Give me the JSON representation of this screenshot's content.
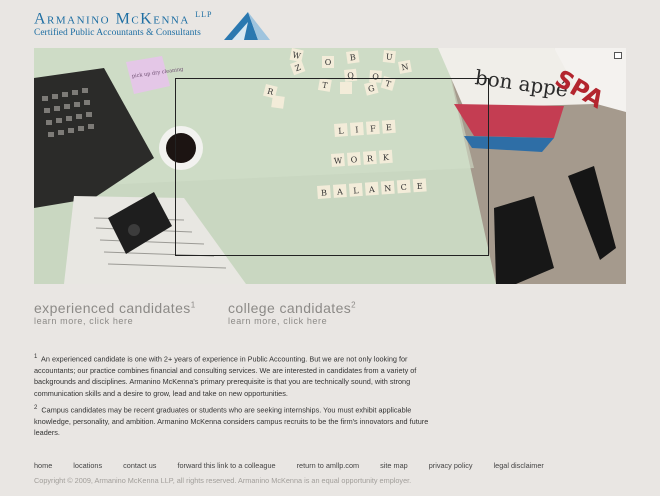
{
  "header": {
    "logo_word": "Armanino McKenna",
    "logo_suffix": "LLP",
    "logo_tagline": "Certified Public Accountants & Consultants"
  },
  "hero": {
    "expand_icon": "expand-icon",
    "tiles_top": [
      "W",
      "O",
      "B",
      "U",
      "N",
      "R",
      "Z",
      "T",
      "Q",
      "O",
      "G",
      "T"
    ],
    "tiles_life": [
      "L",
      "I",
      "F",
      "E"
    ],
    "tiles_work": [
      "W",
      "O",
      "R",
      "K"
    ],
    "tiles_balance": [
      "B",
      "A",
      "L",
      "A",
      "N",
      "C",
      "E"
    ],
    "sticky_note": "pick up dry cleaning",
    "magazine_1": "bon appé",
    "magazine_2": "SPA"
  },
  "candidates": {
    "experienced": {
      "title": "experienced candidates",
      "marker": "1",
      "link": "learn more, click here"
    },
    "college": {
      "title": "college candidates",
      "marker": "2",
      "link": "learn more, click here"
    }
  },
  "footnotes": {
    "fn1": {
      "marker": "1",
      "text": "An experienced candidate is one with 2+ years of experience in Public Accounting. But we are not only looking for accountants; our practice combines financial and consulting services. We are interested in candidates from a variety of backgrounds and disciplines. Armanino McKenna's primary prerequisite is that you are technically sound, with strong communication skills and a desire to grow, lead and take on new opportunities."
    },
    "fn2": {
      "marker": "2",
      "text": "Campus candidates may be recent graduates or students who are seeking internships. You must exhibit applicable knowledge, personality, and ambition. Armanino McKenna considers campus recruits to be the firm's innovators and future leaders."
    }
  },
  "footer": {
    "links": [
      "home",
      "locations",
      "contact us",
      "forward this link to a colleague",
      "return to amllp.com",
      "site map",
      "privacy policy",
      "legal disclaimer"
    ],
    "copyright": "Copyright © 2009, Armanino McKenna LLP, all rights reserved. Armanino McKenna is an equal opportunity employer."
  },
  "colors": {
    "brand_blue": "#1f6fa3",
    "muted_text": "#8c8a87",
    "page_bg": "#e9e6e3"
  }
}
